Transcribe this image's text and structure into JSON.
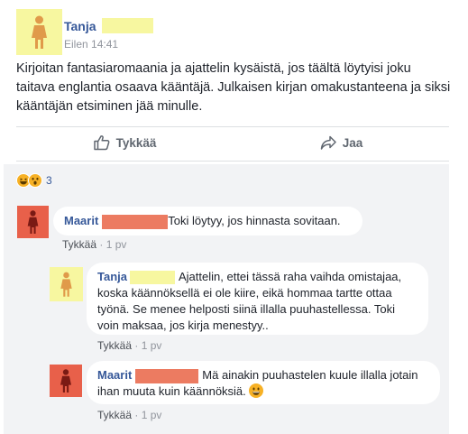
{
  "post": {
    "author": "Tanja",
    "time": "Eilen 14:41",
    "text": "Kirjoitan fantasiaromaania ja ajattelin kysäistä, jos täältä löytyisi joku taitava englantia osaava kääntäjä. Julkaisen kirjan omakustanteena ja siksi kääntäjän etsiminen jää minulle."
  },
  "actions": {
    "like": "Tykkää",
    "share": "Jaa"
  },
  "reactions": {
    "count": "3"
  },
  "comments": [
    {
      "author": "Maarit",
      "text": "Toki löytyy, jos hinnasta sovitaan.",
      "like": "Tykkää",
      "time": "1 pv"
    },
    {
      "author": "Tanja",
      "text": "Ajattelin, ettei tässä raha vaihda omistajaa, koska käännöksellä ei ole kiire, eikä hommaa tartte ottaa työnä. Se menee helposti siinä illalla puuhastellessa. Toki voin maksaa, jos kirja menestyy..",
      "like": "Tykkää",
      "time": "1 pv"
    },
    {
      "author": "Maarit",
      "text": "Mä ainakin puuhastelen kuule illalla jotain ihan muuta kuin käännöksiä.",
      "like": "Tykkää",
      "time": "1 pv"
    }
  ],
  "separator": "·",
  "colors": {
    "link": "#365899",
    "avatar_yellow": "#f7f7a0",
    "avatar_orange": "#e8604a",
    "avatar_figure_tan": "#e09a4a",
    "avatar_figure_dark": "#7a1a14",
    "comments_bg": "#f2f3f5"
  },
  "icons": [
    "thumbs-up-icon",
    "share-arrow-icon",
    "laughing-emoji-icon",
    "wow-emoji-icon",
    "grinning-emoji-icon"
  ]
}
